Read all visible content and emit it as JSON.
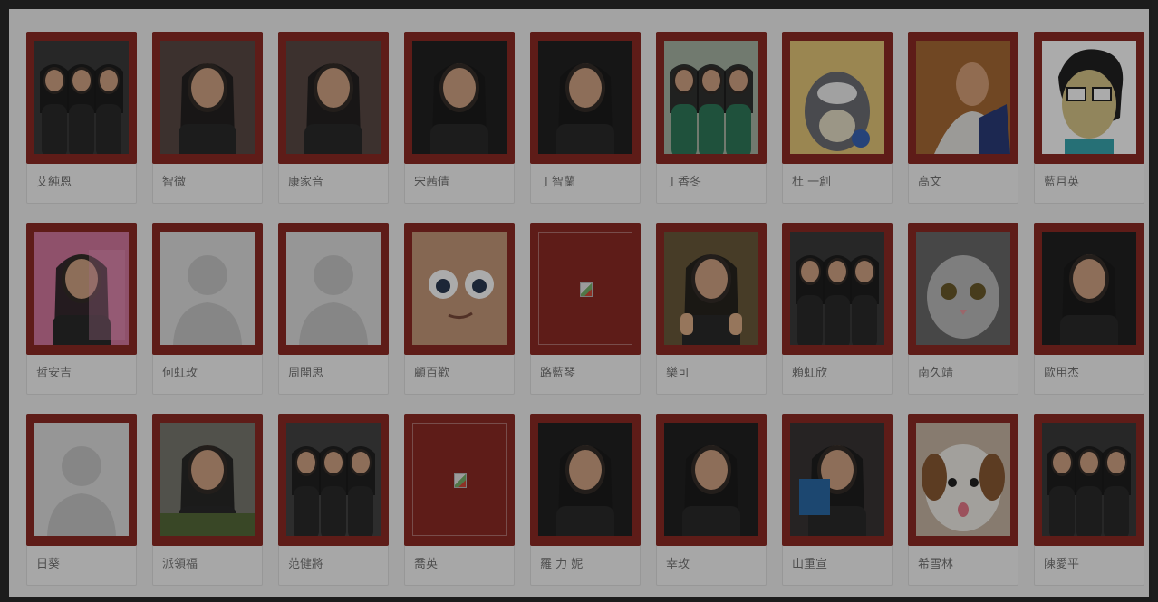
{
  "profiles": [
    {
      "name": "艾純恩",
      "kind": "group",
      "icon": "group-photo-icon"
    },
    {
      "name": "智微",
      "kind": "selfie",
      "icon": "portrait-photo-icon"
    },
    {
      "name": "康家音",
      "kind": "selfie",
      "icon": "portrait-photo-icon"
    },
    {
      "name": "宋茜倩",
      "kind": "dark",
      "icon": "portrait-photo-icon"
    },
    {
      "name": "丁智蘭",
      "kind": "dark",
      "icon": "portrait-photo-icon"
    },
    {
      "name": "丁香冬",
      "kind": "family",
      "icon": "group-photo-icon"
    },
    {
      "name": "杜 一創",
      "kind": "totoro",
      "icon": "cartoon-photo-icon"
    },
    {
      "name": "高文",
      "kind": "painting",
      "icon": "painting-photo-icon"
    },
    {
      "name": "藍月英",
      "kind": "cartoon",
      "icon": "cartoon-avatar-icon"
    },
    {
      "name": "哲安吉",
      "kind": "poster",
      "icon": "portrait-photo-icon"
    },
    {
      "name": "何虹玫",
      "kind": "default",
      "icon": "default-avatar-icon"
    },
    {
      "name": "周開思",
      "kind": "default",
      "icon": "default-avatar-icon"
    },
    {
      "name": "顧百歡",
      "kind": "face",
      "icon": "cartoon-face-icon"
    },
    {
      "name": "路藍琴",
      "kind": "broken",
      "icon": "broken-image-icon"
    },
    {
      "name": "樂可",
      "kind": "thumbs",
      "icon": "portrait-photo-icon"
    },
    {
      "name": "賴虹欣",
      "kind": "group",
      "icon": "group-photo-icon"
    },
    {
      "name": "南久靖",
      "kind": "cat",
      "icon": "cat-photo-icon"
    },
    {
      "name": "歐用杰",
      "kind": "dark",
      "icon": "portrait-photo-icon"
    },
    {
      "name": "日葵",
      "kind": "default",
      "icon": "default-avatar-icon"
    },
    {
      "name": "派領福",
      "kind": "paintball",
      "icon": "action-photo-icon"
    },
    {
      "name": "范健將",
      "kind": "class",
      "icon": "group-photo-icon"
    },
    {
      "name": "喬英",
      "kind": "broken",
      "icon": "broken-image-icon"
    },
    {
      "name": "羅 力 妮",
      "kind": "dark",
      "icon": "portrait-photo-icon"
    },
    {
      "name": "幸玫",
      "kind": "dark",
      "icon": "portrait-photo-icon"
    },
    {
      "name": "山重宣",
      "kind": "book",
      "icon": "portrait-photo-icon"
    },
    {
      "name": "希雪林",
      "kind": "dog",
      "icon": "dog-photo-icon"
    },
    {
      "name": "陳愛平",
      "kind": "group",
      "icon": "group-photo-icon"
    }
  ],
  "colors": {
    "frame": "#8d2a24",
    "card_bg": "#fafafa",
    "overlay": "rgba(0,0,0,0.33)"
  }
}
